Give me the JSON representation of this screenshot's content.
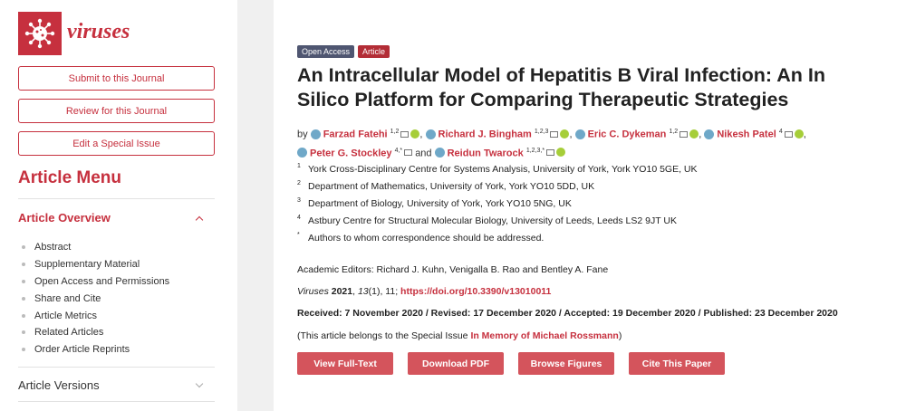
{
  "journal": {
    "name": "viruses",
    "logo_icon": "virus-icon",
    "brand_color": "#c6303e"
  },
  "sidebar": {
    "buttons": [
      "Submit to this Journal",
      "Review for this Journal",
      "Edit a Special Issue"
    ],
    "menu_title": "Article Menu",
    "overview_label": "Article Overview",
    "overview_items": [
      "Abstract",
      "Supplementary Material",
      "Open Access and Permissions",
      "Share and Cite",
      "Article Metrics",
      "Related Articles",
      "Order Article Reprints"
    ],
    "versions_label": "Article Versions"
  },
  "article": {
    "badges": [
      "Open Access",
      "Article"
    ],
    "title": "An Intracellular Model of Hepatitis B Viral Infection: An In Silico Platform for Comparing Therapeutic Strategies",
    "by_label": "by",
    "and_label": "and",
    "authors": [
      {
        "name": "Farzad Fatehi",
        "sup": "1,2"
      },
      {
        "name": "Richard J. Bingham",
        "sup": "1,2,3"
      },
      {
        "name": "Eric C. Dykeman",
        "sup": "1,2"
      },
      {
        "name": "Nikesh Patel",
        "sup": "4"
      },
      {
        "name": "Peter G. Stockley",
        "sup": "4,*"
      },
      {
        "name": "Reidun Twarock",
        "sup": "1,2,3,*"
      }
    ],
    "affiliations": [
      {
        "n": "1",
        "text": "York Cross-Disciplinary Centre for Systems Analysis, University of York, York YO10 5GE, UK"
      },
      {
        "n": "2",
        "text": "Department of Mathematics, University of York, York YO10 5DD, UK"
      },
      {
        "n": "3",
        "text": "Department of Biology, University of York, York YO10 5NG, UK"
      },
      {
        "n": "4",
        "text": "Astbury Centre for Structural Molecular Biology, University of Leeds, Leeds LS2 9JT UK"
      },
      {
        "n": "*",
        "text": "Authors to whom correspondence should be addressed."
      }
    ],
    "editors": "Academic Editors: Richard J. Kuhn, Venigalla B. Rao and Bentley A. Fane",
    "citation": {
      "journal": "Viruses",
      "year": "2021",
      "volume": "13",
      "issue_pages": "(1), 11;",
      "doi": "https://doi.org/10.3390/v13010011"
    },
    "dates": "Received: 7 November 2020 / Revised: 17 December 2020 / Accepted: 19 December 2020 / Published: 23 December 2020",
    "special_issue": {
      "prefix": "(This article belongs to the Special Issue ",
      "link": "In Memory of Michael Rossmann",
      "suffix": ")"
    },
    "actions": [
      "View Full-Text",
      "Download PDF",
      "Browse Figures",
      "Cite This Paper"
    ]
  }
}
